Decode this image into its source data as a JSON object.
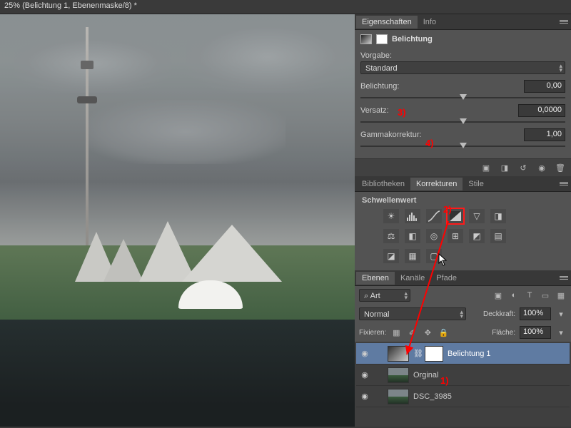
{
  "titlebar": "25% (Belichtung 1, Ebenenmaske/8) *",
  "panels": {
    "props_tab": "Eigenschaften",
    "info_tab": "Info",
    "lib_tab": "Bibliotheken",
    "korr_tab": "Korrekturen",
    "style_tab": "Stile",
    "layers_tab": "Ebenen",
    "channels_tab": "Kanäle",
    "paths_tab": "Pfade"
  },
  "props": {
    "title": "Belichtung",
    "preset_label": "Vorgabe:",
    "preset_value": "Standard",
    "exposure_label": "Belichtung:",
    "exposure_value": "0,00",
    "offset_label": "Versatz:",
    "offset_value": "0,0000",
    "gamma_label": "Gammakorrektur:",
    "gamma_value": "1,00"
  },
  "korr": {
    "heading": "Schwellenwert"
  },
  "layers_opts": {
    "search_label": "Art",
    "blend_mode": "Normal",
    "opacity_label": "Deckkraft:",
    "opacity_value": "100%",
    "lock_label": "Fixieren:",
    "fill_label": "Fläche:",
    "fill_value": "100%"
  },
  "layers": [
    {
      "name": "Belichtung 1",
      "type": "adjustment",
      "selected": true
    },
    {
      "name": "Orginal",
      "type": "image",
      "selected": false
    },
    {
      "name": "DSC_3985",
      "type": "image",
      "selected": false
    }
  ],
  "icons": {
    "search": "⌕",
    "eye": "👁",
    "trash": "🗑",
    "reset": "⟳",
    "clip": "⬓"
  },
  "annotations": {
    "a1": "1)",
    "a2": "2)",
    "a3": "3)",
    "a4": "4)"
  }
}
